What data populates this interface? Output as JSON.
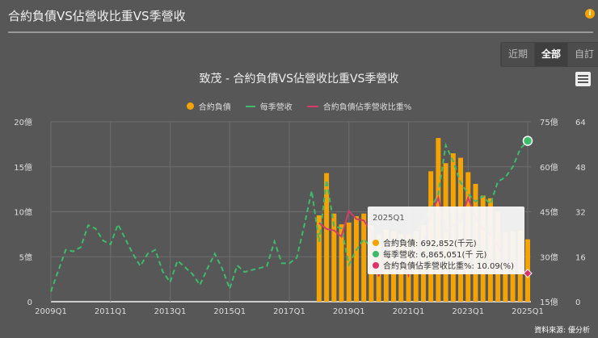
{
  "header": {
    "title": "合約負債VS佔營收比重VS季營收",
    "info_icon": "i"
  },
  "range_buttons": [
    {
      "label": "近期"
    },
    {
      "label": "全部",
      "active": true
    },
    {
      "label": "自訂"
    }
  ],
  "source": "資料來源: 優分析",
  "tooltip": {
    "title": "2025Q1",
    "rows": [
      {
        "label": "合約負債: 692,852(千元)",
        "color": "#f5a300"
      },
      {
        "label": "每季營收: 6,865,051(千 元)",
        "color": "#3dbb6b"
      },
      {
        "label": "合約負債佔季營收比重%: 10.09(%)",
        "color": "#e0306a"
      }
    ]
  },
  "chart_data": {
    "type": "bar+line",
    "title": "致茂 - 合約負債VS佔營收比重VS季營收",
    "x_start": "2009Q1",
    "x_end": "2025Q1",
    "x_ticks": [
      "2009Q1",
      "2011Q1",
      "2013Q1",
      "2015Q1",
      "2017Q1",
      "2019Q1",
      "2021Q1",
      "2023Q1",
      "2025Q1"
    ],
    "axes": {
      "left": {
        "ticks": [
          "0",
          "5億",
          "10億",
          "15億",
          "20億"
        ],
        "range": [
          0,
          20
        ],
        "unit": "億"
      },
      "right1": {
        "ticks": [
          "15億",
          "30億",
          "45億",
          "60億",
          "75億"
        ],
        "range": [
          15,
          75
        ],
        "unit": "億"
      },
      "right2": {
        "ticks": [
          "0",
          "16",
          "32",
          "48",
          "64"
        ],
        "range": [
          0,
          64
        ]
      }
    },
    "legend": [
      "合約負債",
      "每季營收",
      "合約負債佔季營收比重%"
    ],
    "legend_position": "top",
    "series": [
      {
        "name": "合約負債",
        "type": "bar",
        "axis": "left",
        "color": "#f5a300",
        "start": "2018Q1",
        "values": [
          9.6,
          14.3,
          9.8,
          8.6,
          8.8,
          9.5,
          9.8,
          8.5,
          7.5,
          8.0,
          7.8,
          7.5,
          7.5,
          7.8,
          8.5,
          14.5,
          18.2,
          15.4,
          16.5,
          16.0,
          14.4,
          13.1,
          11.8,
          11.5,
          10.0,
          7.7,
          7.8,
          7.9,
          6.93
        ]
      },
      {
        "name": "每季營收",
        "type": "line-dashed",
        "axis": "right1",
        "color": "#3dbb6b",
        "start": "2009Q1",
        "values": [
          18.4,
          25.4,
          32.3,
          31.8,
          33.2,
          40.5,
          39.4,
          35.4,
          34.1,
          40.8,
          35.9,
          31,
          26.9,
          31,
          32.3,
          25.1,
          21.5,
          28.7,
          26.5,
          24.2,
          20.6,
          26,
          31,
          26,
          19.3,
          27.1,
          24.9,
          25.6,
          26.2,
          26.9,
          35.1,
          27.8,
          27.8,
          29.6,
          40.3,
          52,
          35,
          55.6,
          40.3,
          39.4,
          27.4,
          32.3,
          35.9,
          33,
          30,
          32,
          34,
          36,
          35,
          38,
          42,
          46,
          51,
          67.2,
          61.8,
          54.7,
          51,
          48.4,
          50.2,
          47.5,
          55.1,
          56.5,
          60,
          66,
          68.65
        ]
      },
      {
        "name": "合約負債佔季營收比重%",
        "type": "line",
        "axis": "right2",
        "color": "#d63c6a",
        "start": "2018Q1",
        "values": [
          28,
          25.9,
          25.4,
          23.2,
          32.3,
          29.4,
          28.9,
          25,
          9,
          20,
          18,
          17,
          9.4,
          18,
          20,
          31,
          37,
          25,
          27,
          29,
          37,
          30,
          26,
          24,
          20,
          14,
          13,
          12,
          10.09
        ]
      }
    ]
  }
}
